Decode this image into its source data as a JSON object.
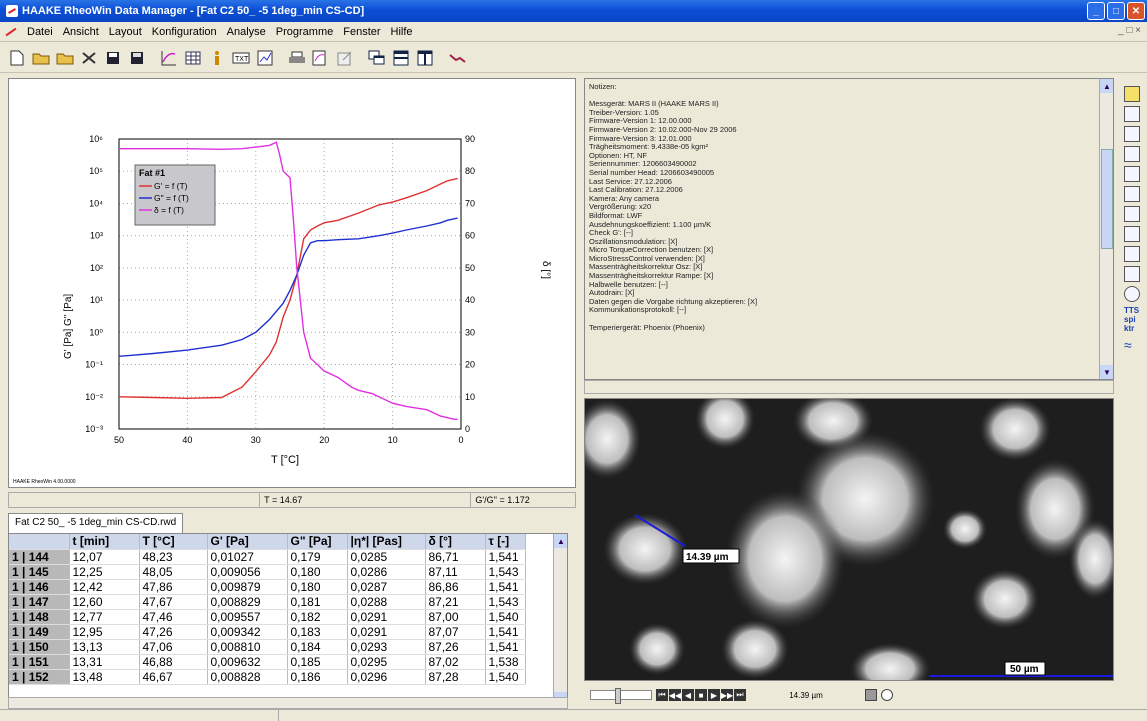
{
  "window": {
    "title": "HAAKE RheoWin Data Manager - [Fat C2 50_ -5 1deg_min CS-CD]"
  },
  "menu": [
    "Datei",
    "Ansicht",
    "Layout",
    "Konfiguration",
    "Analyse",
    "Programme",
    "Fenster",
    "Hilfe"
  ],
  "chart": {
    "legend_title": "Fat #1",
    "legend": [
      "G' = f (T)",
      "G\" = f (T)",
      "δ = f (T)"
    ],
    "ylabel_left": "G' [Pa] G'' [Pa]",
    "ylabel_right": "δ [°]",
    "xlabel": "T [°C]",
    "footer": "HAAKE RheoWin 4.00.0000",
    "left_ticks": [
      "10⁻³",
      "10⁻²",
      "10⁻¹",
      "10⁰",
      "10¹",
      "10²",
      "10³",
      "10⁴",
      "10⁵",
      "10⁶"
    ],
    "right_ticks": [
      "0",
      "10",
      "20",
      "30",
      "40",
      "50",
      "60",
      "70",
      "80",
      "90"
    ],
    "x_ticks": [
      "50",
      "40",
      "30",
      "20",
      "10",
      "0"
    ]
  },
  "chart_data": {
    "type": "line",
    "xlabel": "T [°C]",
    "ylabel": "G' [Pa] G'' [Pa]",
    "y2label": "δ [°]",
    "xlim": [
      50,
      0
    ],
    "ylim_log10": [
      -3,
      6
    ],
    "y2lim": [
      0,
      90
    ],
    "series": [
      {
        "name": "G' = f (T)",
        "axis": "left_log",
        "color": "#e03030",
        "x": [
          50,
          45,
          40,
          35,
          32,
          30,
          28,
          27,
          26,
          25,
          24,
          23,
          22,
          21,
          20,
          18,
          15,
          12,
          10,
          8,
          5,
          3,
          2,
          0.5
        ],
        "y": [
          0.01,
          0.0095,
          0.009,
          0.0095,
          0.02,
          0.06,
          0.2,
          0.5,
          3,
          10,
          60,
          800,
          1500,
          2000,
          2500,
          3000,
          5000,
          9000,
          11000,
          15000,
          25000,
          40000,
          50000,
          60000
        ]
      },
      {
        "name": "G\" = f (T)",
        "axis": "left_log",
        "color": "#2030d0",
        "x": [
          50,
          45,
          40,
          35,
          32,
          30,
          28,
          26,
          25,
          24,
          23,
          22,
          21,
          20,
          18,
          15,
          12,
          10,
          8,
          5,
          3,
          2,
          0.5
        ],
        "y": [
          0.18,
          0.22,
          0.28,
          0.4,
          0.6,
          1,
          2.5,
          8,
          20,
          60,
          250,
          600,
          700,
          700,
          750,
          800,
          1000,
          1200,
          1500,
          2000,
          2500,
          3000,
          3500
        ]
      },
      {
        "name": "δ = f (T)",
        "axis": "right",
        "color": "#e030e0",
        "x": [
          50,
          45,
          40,
          35,
          32,
          30,
          28,
          27,
          26.5,
          26,
          25,
          24.5,
          24,
          23.5,
          23,
          22,
          21,
          20,
          18,
          16,
          15,
          13,
          12,
          10,
          8,
          5,
          3,
          1,
          0.5
        ],
        "y": [
          87,
          87,
          87,
          86.8,
          87,
          87.5,
          88,
          89,
          85,
          80,
          78,
          65,
          50,
          40,
          30,
          22,
          20,
          18,
          16,
          13,
          12,
          11,
          10,
          8,
          7,
          6,
          4,
          3,
          3
        ]
      }
    ]
  },
  "status": {
    "temp": "T = 14.67",
    "ratio": "G'/G'' = 1.172"
  },
  "file_tab": "Fat C2 50_ -5 1deg_min CS-CD.rwd",
  "table": {
    "headers": [
      "",
      "t [min]",
      "T [°C]",
      "G' [Pa]",
      "G\" [Pa]",
      "|η*| [Pas]",
      "δ [°]",
      "τ [-]"
    ],
    "rows": [
      [
        "1 | 144",
        "12,07",
        "48,23",
        "0,01027",
        "0,179",
        "0,0285",
        "86,71",
        "1,541"
      ],
      [
        "1 | 145",
        "12,25",
        "48,05",
        "0,009056",
        "0,180",
        "0,0286",
        "87,11",
        "1,543"
      ],
      [
        "1 | 146",
        "12,42",
        "47,86",
        "0,009879",
        "0,180",
        "0,0287",
        "86,86",
        "1,541"
      ],
      [
        "1 | 147",
        "12,60",
        "47,67",
        "0,008829",
        "0,181",
        "0,0288",
        "87,21",
        "1,543"
      ],
      [
        "1 | 148",
        "12,77",
        "47,46",
        "0,009557",
        "0,182",
        "0,0291",
        "87,00",
        "1,540"
      ],
      [
        "1 | 149",
        "12,95",
        "47,26",
        "0,009342",
        "0,183",
        "0,0291",
        "87,07",
        "1,541"
      ],
      [
        "1 | 150",
        "13,13",
        "47,06",
        "0,008810",
        "0,184",
        "0,0293",
        "87,26",
        "1,541"
      ],
      [
        "1 | 151",
        "13,31",
        "46,88",
        "0,009632",
        "0,185",
        "0,0295",
        "87,02",
        "1,538"
      ],
      [
        "1 | 152",
        "13,48",
        "46,67",
        "0,008828",
        "0,186",
        "0,0296",
        "87,28",
        "1,540"
      ]
    ]
  },
  "notes": {
    "header": "Notizen:",
    "lines": [
      "Messgerät: MARS II (HAAKE MARS II)",
      "Treiber-Version: 1.05",
      "Firmware-Version 1: 12.00.000",
      "Firmware-Version 2: 10.02.000-Nov 29 2006",
      "Firmware-Version 3: 12.01.000",
      "Trägheitsmoment: 9.4338e-05 kgm²",
      "Optionen: HT, NF",
      "Seriennummer: 1206603490002",
      "Serial number Head: 1206603490005",
      "Last Service: 27.12.2006",
      "Last Calibration: 27.12.2006",
      "Kamera: Any camera",
      "Vergrößerung: x20",
      "Bildformat: LWF",
      "Ausdehnungskoeffizient: 1.100 µm/K",
      "Check G': [--]",
      "Oszillationsmodulation: [X]",
      "Micro TorqueCorrection benutzen: [X]",
      "MicroStressControl verwenden: [X]",
      "Massenträgheitskorrektur Osz: [X]",
      "Massenträgheitskorrektur Rampe: [X]",
      "Halbwelle benutzen: [--]",
      "Autodrain: [X]",
      "Daten gegen die Vorgabe richtung akzeptieren: [X]",
      "Kommunikationsprotokoll: [--]",
      "",
      "Temperiergerät: Phoenix (Phoenix)"
    ]
  },
  "image": {
    "measure_label": "14.39 µm",
    "scale_label": "50 µm",
    "readout": "14.39 µm"
  },
  "sidebar": {
    "label1": "TTS",
    "label2": "spi ktr"
  }
}
